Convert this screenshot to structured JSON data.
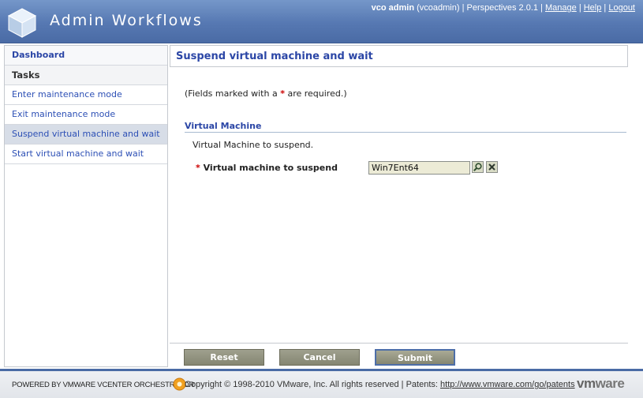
{
  "header": {
    "title": "Admin Workflows",
    "user_name": "vco admin",
    "user_id": "(vcoadmin)",
    "separator": "|",
    "perspectives": "Perspectives 2.0.1",
    "manage_link": "Manage",
    "help_link": "Help",
    "logout_link": "Logout"
  },
  "sidebar": {
    "dashboard_label": "Dashboard",
    "tasks_label": "Tasks",
    "items": [
      {
        "label": "Enter maintenance mode"
      },
      {
        "label": "Exit maintenance mode"
      },
      {
        "label": "Suspend virtual machine and wait",
        "selected": true
      },
      {
        "label": "Start virtual machine and wait"
      }
    ]
  },
  "main": {
    "title": "Suspend virtual machine and wait",
    "required_note_prefix": "(Fields marked with a",
    "required_star": "*",
    "required_note_suffix": "are required.)",
    "section_title": "Virtual Machine",
    "section_description": "Virtual Machine to suspend.",
    "field": {
      "star": "*",
      "label": "Virtual machine to suspend",
      "value": "Win7Ent64"
    }
  },
  "actions": {
    "reset_label": "Reset",
    "cancel_label": "Cancel",
    "submit_label": "Submit"
  },
  "footer": {
    "powered_by": "POWERED BY VMWARE VCENTER ORCHESTRATOR",
    "copyright": "Copyright © 1998-2010 VMware, Inc. All rights reserved | Patents:",
    "patents_link": "http://www.vmware.com/go/patents",
    "brand_vm": "vm",
    "brand_ware": "ware"
  },
  "icons": {
    "logo": "cube-icon",
    "search": "magnifier-icon",
    "clear": "close-icon",
    "orchestrator": "orchestrator-logo-icon"
  },
  "colors": {
    "header": "#5678b2",
    "link": "#2c4fb5",
    "required": "#cc0000",
    "button": "#858672"
  }
}
